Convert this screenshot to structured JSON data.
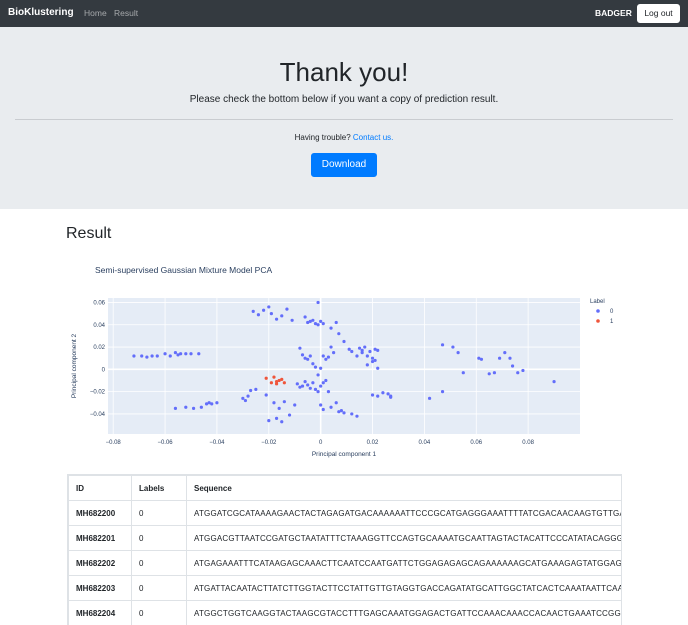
{
  "navbar": {
    "brand": "BioKlustering",
    "links": [
      "Home",
      "Result"
    ],
    "user": "BADGER",
    "logout_label": "Log out"
  },
  "jumbotron": {
    "title": "Thank you!",
    "lead": "Please check the bottom below if you want a copy of prediction result.",
    "trouble_text": "Having trouble?",
    "contact_link": "Contact us.",
    "download_label": "Download"
  },
  "result": {
    "heading": "Result"
  },
  "chart_data": {
    "type": "scatter",
    "title": "Semi-supervised Gaussian Mixture Model PCA",
    "xlabel": "Principal component 1",
    "ylabel": "Principal component 2",
    "xlim": [
      -0.082,
      0.1
    ],
    "ylim": [
      -0.058,
      0.064
    ],
    "xticks": [
      -0.08,
      -0.06,
      -0.04,
      -0.02,
      0,
      0.02,
      0.04,
      0.06,
      0.08
    ],
    "xtick_labels": [
      "−0.08",
      "−0.06",
      "−0.04",
      "−0.02",
      "0",
      "0.02",
      "0.04",
      "0.06",
      "0.08"
    ],
    "yticks": [
      0.06,
      0.04,
      0.02,
      0,
      -0.02,
      -0.04
    ],
    "ytick_labels": [
      "0.06",
      "0.04",
      "0.02",
      "0",
      "−0.02",
      "−0.04"
    ],
    "grid": true,
    "legend": {
      "title": "Label",
      "placement": "right"
    },
    "series": [
      {
        "name": "0",
        "color": "#636efa",
        "x": [
          -0.072,
          -0.069,
          -0.067,
          -0.065,
          -0.063,
          -0.06,
          -0.058,
          -0.056,
          -0.055,
          -0.054,
          -0.052,
          -0.05,
          -0.047,
          -0.056,
          -0.052,
          -0.049,
          -0.046,
          -0.044,
          -0.043,
          -0.042,
          -0.04,
          -0.03,
          -0.029,
          -0.028,
          -0.027,
          -0.026,
          -0.024,
          -0.022,
          -0.02,
          -0.019,
          -0.017,
          -0.015,
          -0.013,
          -0.011,
          -0.025,
          -0.021,
          -0.018,
          -0.016,
          -0.014,
          -0.012,
          -0.01,
          -0.02,
          -0.017,
          -0.015,
          -0.006,
          -0.004,
          -0.002,
          -0.001,
          -0.005,
          -0.003,
          -0.001,
          0.0,
          0.001,
          -0.008,
          -0.007,
          -0.006,
          -0.005,
          -0.004,
          -0.003,
          -0.002,
          -0.001,
          0.0,
          0.001,
          0.002,
          0.003,
          0.004,
          0.005,
          -0.009,
          -0.008,
          -0.007,
          -0.006,
          -0.005,
          -0.004,
          -0.003,
          -0.002,
          -0.001,
          0.0,
          0.001,
          0.002,
          0.003,
          0.006,
          0.008,
          0.009,
          0.012,
          0.014,
          0.004,
          0.006,
          0.007,
          0.009,
          0.011,
          0.012,
          0.014,
          0.015,
          0.016,
          0.016,
          0.017,
          0.018,
          0.019,
          0.02,
          0.021,
          0.022,
          0.018,
          0.02,
          0.021,
          0.022,
          0.0,
          0.001,
          0.004,
          0.007,
          0.02,
          0.022,
          0.024,
          0.026,
          0.027,
          0.027,
          0.042,
          0.047,
          0.047,
          0.051,
          0.053,
          0.055,
          0.061,
          0.062,
          0.065,
          0.067,
          0.069,
          0.071,
          0.073,
          0.074,
          0.076,
          0.078,
          0.09
        ],
        "y": [
          0.012,
          0.012,
          0.011,
          0.012,
          0.012,
          0.014,
          0.012,
          0.015,
          0.013,
          0.014,
          0.014,
          0.014,
          0.014,
          -0.035,
          -0.034,
          -0.035,
          -0.034,
          -0.031,
          -0.03,
          -0.031,
          -0.03,
          -0.026,
          -0.028,
          -0.024,
          -0.019,
          0.052,
          0.049,
          0.053,
          0.056,
          0.05,
          0.045,
          0.048,
          0.054,
          0.044,
          -0.018,
          -0.023,
          -0.03,
          -0.035,
          -0.029,
          -0.041,
          -0.032,
          -0.046,
          -0.044,
          -0.047,
          0.047,
          0.043,
          0.041,
          0.06,
          0.042,
          0.044,
          0.04,
          0.043,
          0.041,
          0.019,
          0.013,
          0.01,
          0.009,
          0.012,
          0.005,
          0.002,
          -0.005,
          0.001,
          0.012,
          0.009,
          0.011,
          0.02,
          0.015,
          -0.013,
          -0.016,
          -0.015,
          -0.011,
          -0.014,
          -0.017,
          -0.012,
          -0.018,
          -0.02,
          -0.015,
          -0.012,
          -0.01,
          -0.02,
          -0.03,
          -0.037,
          -0.039,
          -0.04,
          -0.042,
          0.037,
          0.042,
          0.032,
          0.025,
          0.018,
          0.016,
          0.012,
          0.019,
          0.015,
          0.017,
          0.02,
          0.012,
          0.016,
          0.01,
          0.018,
          0.017,
          0.004,
          0.007,
          0.008,
          0.001,
          -0.032,
          -0.036,
          -0.034,
          -0.038,
          -0.023,
          -0.024,
          -0.021,
          -0.022,
          -0.025,
          -0.024,
          -0.026,
          -0.02,
          0.022,
          0.02,
          0.015,
          -0.003,
          0.01,
          0.009,
          -0.004,
          -0.003,
          0.01,
          0.015,
          0.01,
          0.003,
          -0.003,
          -0.001,
          -0.011
        ]
      },
      {
        "name": "1",
        "color": "#ef553b",
        "x": [
          -0.021,
          -0.019,
          -0.017,
          -0.016,
          -0.015,
          -0.014,
          -0.017,
          -0.018
        ],
        "y": [
          -0.008,
          -0.012,
          -0.011,
          -0.01,
          -0.009,
          -0.012,
          -0.013,
          -0.007
        ]
      }
    ]
  },
  "table": {
    "headers": [
      "ID",
      "Labels",
      "Sequence"
    ],
    "rows": [
      {
        "id": "MH682200",
        "label": "0",
        "sequence": "ATGGATCGCATAAAAGAACTACTAGAGATGACAAAAAATTCCCGCATGAGGGAAATTTTATCGACAACAAGTGTTGACCAG"
      },
      {
        "id": "MH682201",
        "label": "0",
        "sequence": "ATGGACGTTAATCCGATGCTAATATTTCTAAAGGTTCCAGTGCAAAATGCAATTAGTACTACATTCCCATATACAGGGGAC"
      },
      {
        "id": "MH682202",
        "label": "0",
        "sequence": "ATGAGAAATTTCATAAGAGCAAACTTCAATCCAATGATTCTGGAGAGAGCAGAAAAAAGCATGAAAGAGTATGGAGAAGAC"
      },
      {
        "id": "MH682203",
        "label": "0",
        "sequence": "ATGATTACAATACTTATCTTGGTACTTCCTATTGTTGTAGGTGACCAGATATGCATTGGCTATCACTCAAATAATTCAACAG"
      },
      {
        "id": "MH682204",
        "label": "0",
        "sequence": "ATGGCTGGTCAAGGTACTAAGCGTACCTTTGAGCAAATGGAGACTGATTCCAAACAAACCACAACTGAAATCCGGTCAGCA"
      }
    ]
  }
}
